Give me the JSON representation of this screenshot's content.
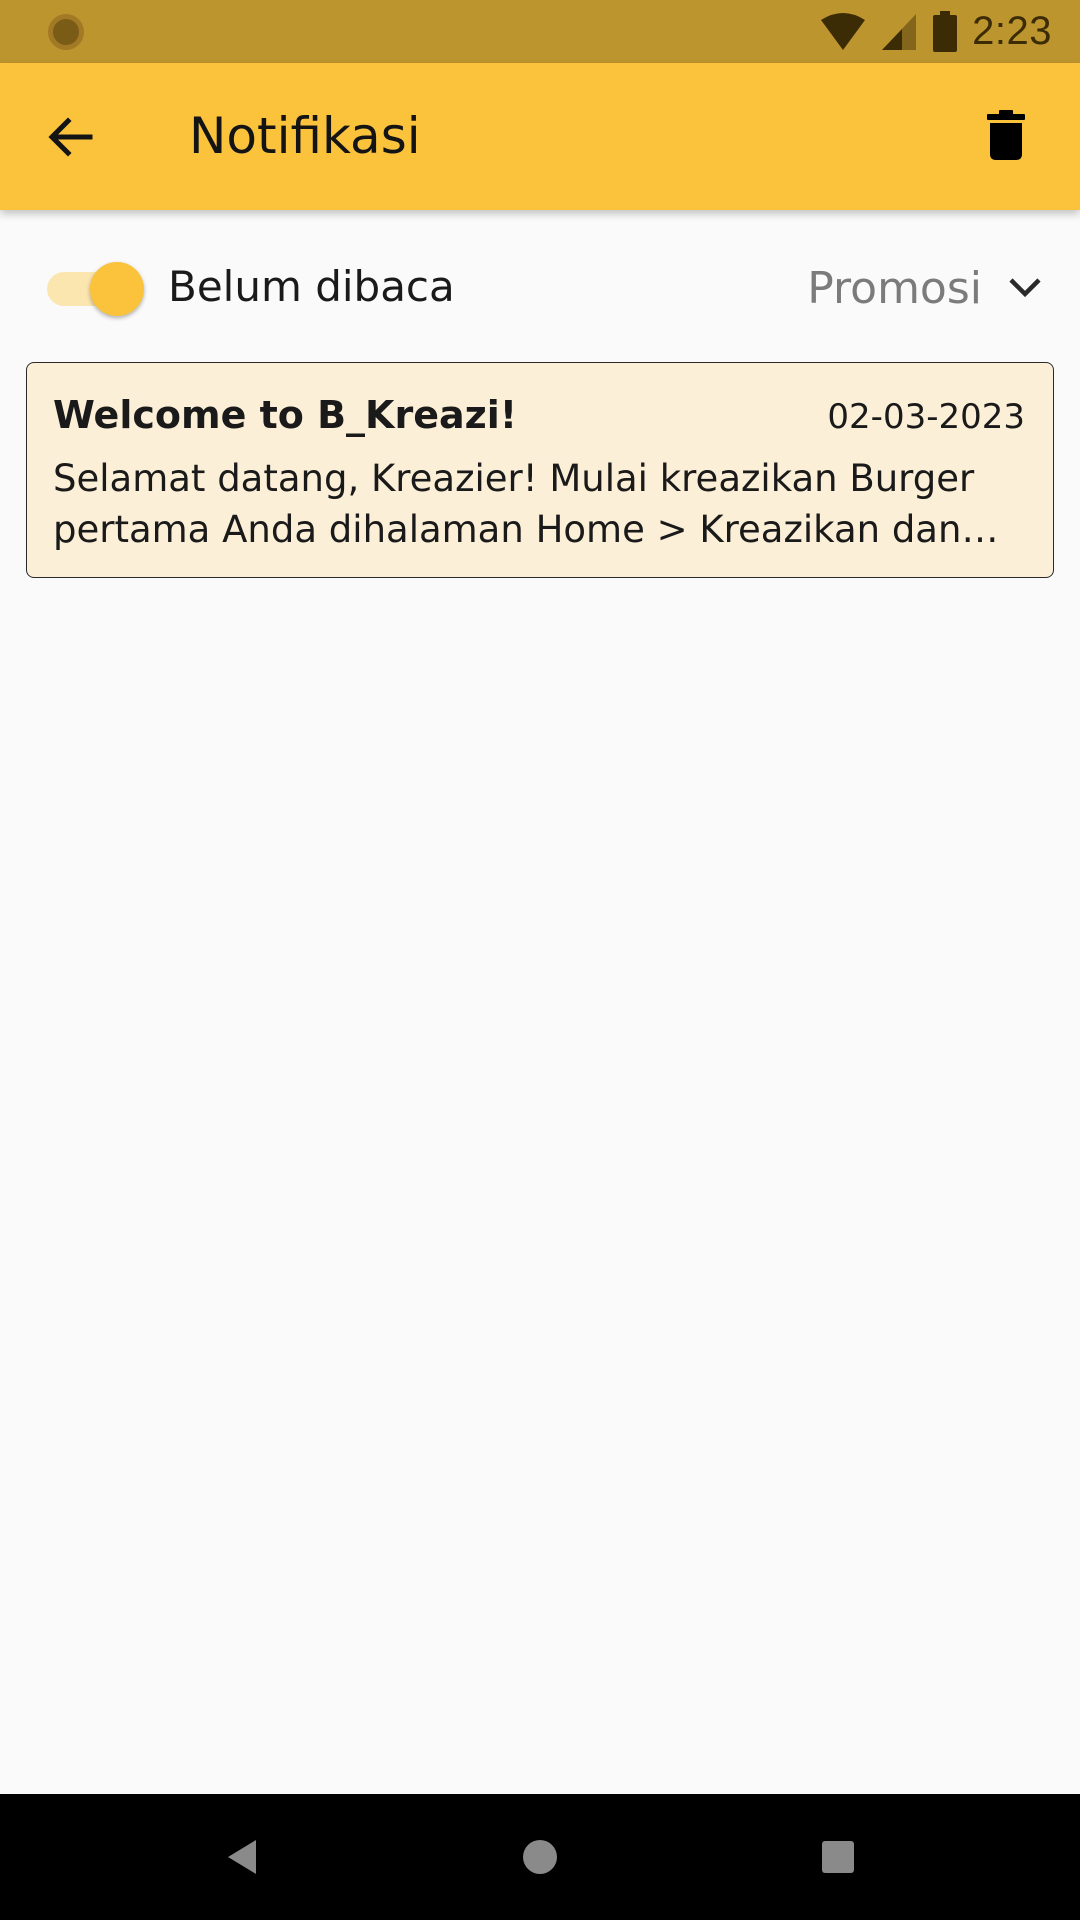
{
  "status_bar": {
    "time": "2:23",
    "icons": [
      "notification-dot-icon",
      "wifi-icon",
      "cellular-signal-icon",
      "battery-icon"
    ]
  },
  "app_bar": {
    "title": "Notifikasi",
    "back_icon": "arrow-back-icon",
    "delete_icon": "trash-icon",
    "background": "#fbc33c"
  },
  "filter": {
    "toggle_label": "Belum dibaca",
    "toggle_on": true,
    "category_selected": "Promosi",
    "category_icon": "chevron-down-icon"
  },
  "notifications": [
    {
      "title": "Welcome to B_Kreazi!",
      "date": "02-03-2023",
      "body": "Selamat datang, Kreazier! Mulai kreazikan Burger pertama Anda dihalaman Home > Kreazikan dan nikmati burger Anda!"
    }
  ],
  "nav_bar": {
    "icons": [
      "back-triangle-icon",
      "home-circle-icon",
      "recents-square-icon"
    ]
  },
  "colors": {
    "status_bar": "#bd952e",
    "accent": "#fbc33c",
    "card_bg": "#fbefd7",
    "page_bg": "#fafafa"
  }
}
